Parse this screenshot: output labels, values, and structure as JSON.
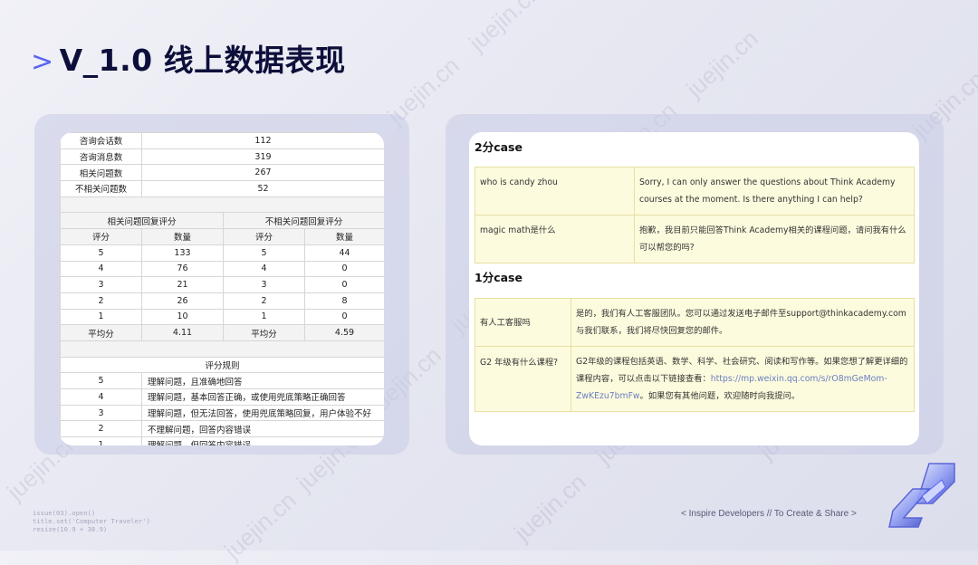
{
  "watermark": "juejin.cn",
  "title": {
    "chevron": ">",
    "text": "V_1.0 线上数据表现"
  },
  "stats": {
    "summary": [
      {
        "label": "咨询会话数",
        "value": "112"
      },
      {
        "label": "咨询消息数",
        "value": "319"
      },
      {
        "label": "相关问题数",
        "value": "267"
      },
      {
        "label": "不相关问题数",
        "value": "52"
      }
    ],
    "related_header": "相关问题回复评分",
    "unrelated_header": "不相关问题回复评分",
    "col_score": "评分",
    "col_count": "数量",
    "score_rows": [
      {
        "s1": "5",
        "c1": "133",
        "s2": "5",
        "c2": "44"
      },
      {
        "s1": "4",
        "c1": "76",
        "s2": "4",
        "c2": "0"
      },
      {
        "s1": "3",
        "c1": "21",
        "s2": "3",
        "c2": "0"
      },
      {
        "s1": "2",
        "c1": "26",
        "s2": "2",
        "c2": "8"
      },
      {
        "s1": "1",
        "c1": "10",
        "s2": "1",
        "c2": "0"
      }
    ],
    "avg_label": "平均分",
    "avg_related": "4.11",
    "avg_unrelated": "4.59",
    "rules_header": "评分规则",
    "rules": [
      {
        "score": "5",
        "desc": "理解问题，且准确地回答"
      },
      {
        "score": "4",
        "desc": "理解问题，基本回答正确，或使用兜底策略正确回答"
      },
      {
        "score": "3",
        "desc": "理解问题，但无法回答，使用兜底策略回复，用户体验不好"
      },
      {
        "score": "2",
        "desc": "不理解问题，回答内容错误"
      },
      {
        "score": "1",
        "desc": "理解问题，但回答内容错误"
      }
    ]
  },
  "cases": {
    "two_heading": "2分case",
    "two": [
      {
        "q": "who is  candy zhou",
        "a": "Sorry, I can only answer the questions about Think Academy courses at the moment. Is there anything I can help?"
      },
      {
        "q": "magic math是什么",
        "a": "抱歉，我目前只能回答Think Academy相关的课程问题，请问我有什么可以帮您的吗?"
      }
    ],
    "one_heading": "1分case",
    "one": [
      {
        "q": "有人工客服吗",
        "a": "是的，我们有人工客服团队。您可以通过发送电子邮件至support@thinkacademy.com与我们联系，我们将尽快回复您的邮件。"
      },
      {
        "q": "G2 年级有什么课程?",
        "a_pre": "G2年级的课程包括英语、数学、科学、社会研究、阅读和写作等。如果您想了解更详细的课程内容，可以点击以下链接查看：",
        "a_link": "https://mp.weixin.qq.com/s/rO8mGeMom-ZwKEzu7bmFw",
        "a_post": "。如果您有其他问题，欢迎随时向我提问。"
      }
    ]
  },
  "footer": "< Inspire Developers  //  To Create & Share >",
  "code_lines": [
    "issue(03).open()",
    "title.set('Computer Traveler')",
    "resize(10.9 + 38.9)"
  ],
  "colors": {
    "accent": "#5b66f0",
    "title": "#0d0f3a",
    "case_bg": "#fdfbde",
    "case_border": "#e6dfa2"
  }
}
